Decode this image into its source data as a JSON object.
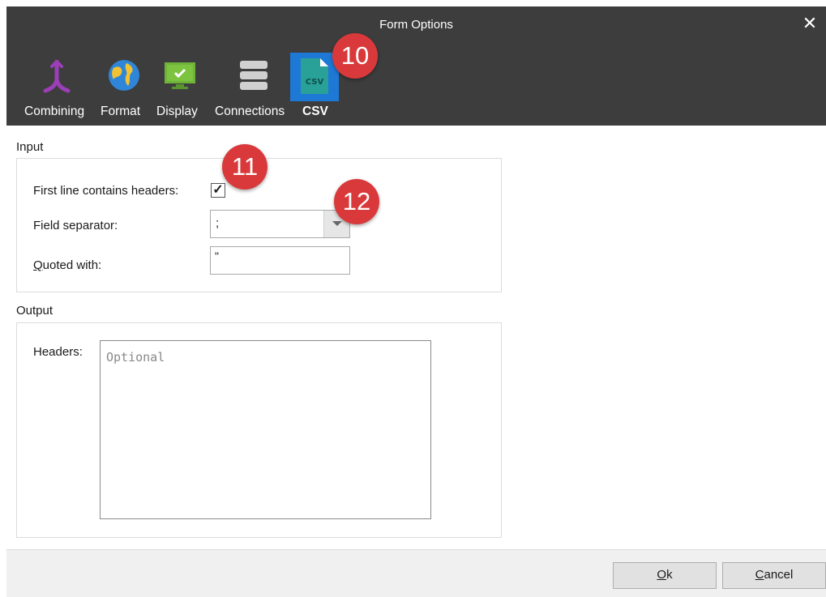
{
  "window": {
    "title": "Form Options",
    "close_glyph": "✕"
  },
  "tabs": [
    {
      "label": "Combining",
      "icon": "combining-icon",
      "color": "#9b3fb8"
    },
    {
      "label": "Format",
      "icon": "globe-icon",
      "color": "#2f86d8"
    },
    {
      "label": "Display",
      "icon": "monitor-check-icon",
      "color": "#6fb33a"
    },
    {
      "label": "Connections",
      "icon": "database-icon",
      "color": "#d0d0d0"
    },
    {
      "label": "CSV",
      "icon": "csv-file-icon",
      "color": "#2aa198",
      "active": true,
      "selected_bg": "#1e78d6"
    }
  ],
  "badges": {
    "b10": "10",
    "b11": "11",
    "b12": "12",
    "color": "#d9393a"
  },
  "input_section": {
    "title": "Input",
    "first_line_label": "First line contains headers:",
    "first_line_checked": "✓",
    "field_separator_label": "Field separator:",
    "field_separator_value": ";",
    "quoted_with_label": "Quoted with:",
    "quoted_with_value": "\""
  },
  "output_section": {
    "title": "Output",
    "headers_label": "Headers:",
    "headers_placeholder": "Optional"
  },
  "footer": {
    "ok_label": "Ok",
    "cancel_label": "Cancel"
  }
}
